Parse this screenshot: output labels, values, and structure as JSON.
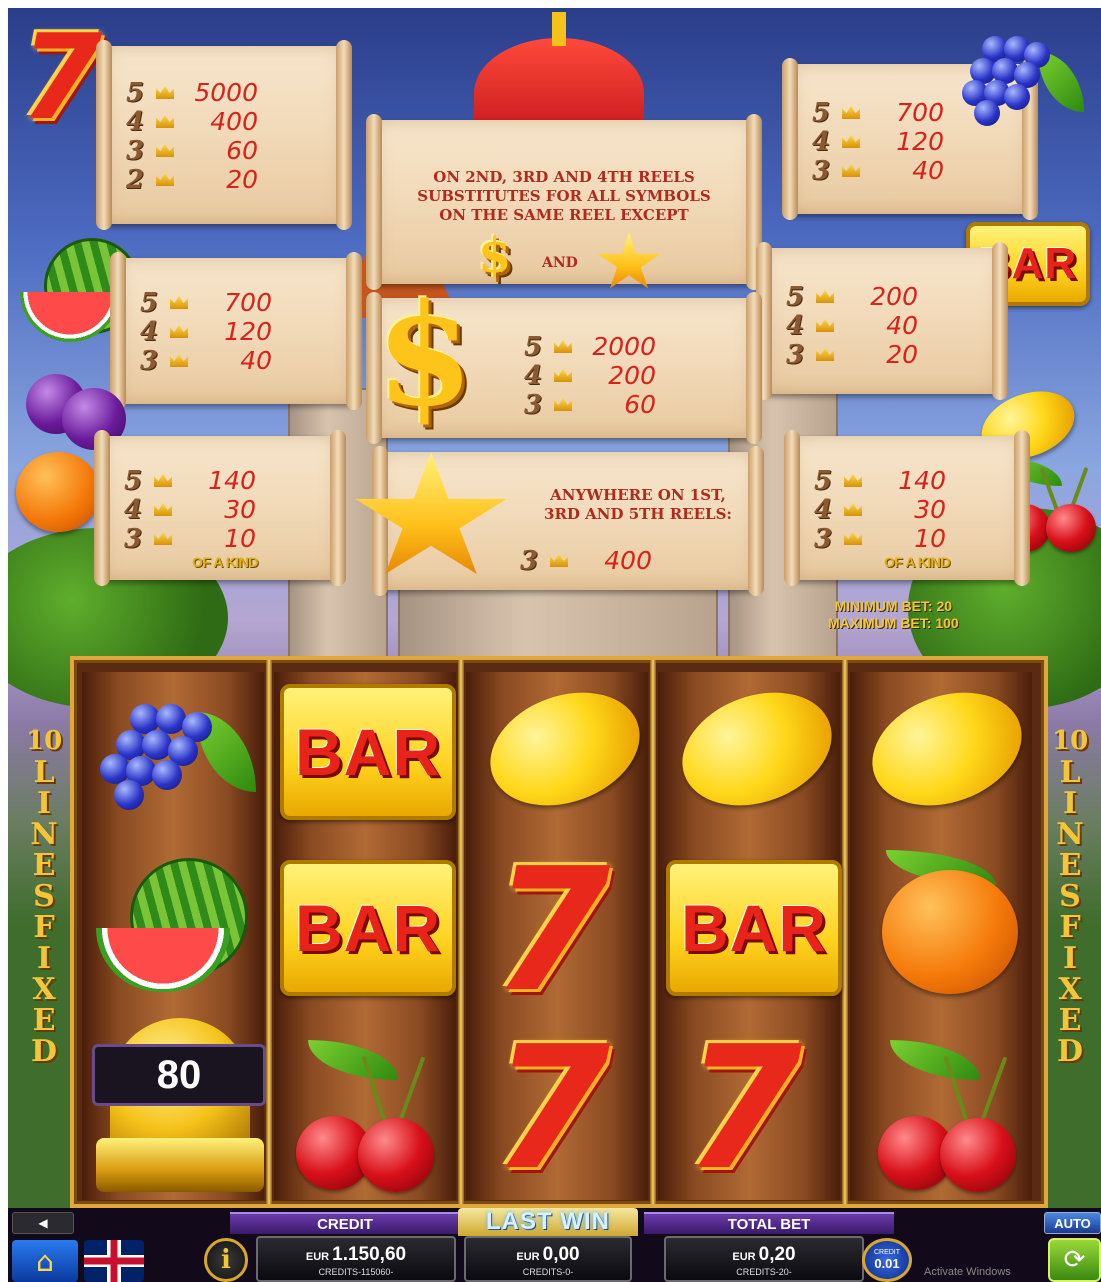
{
  "paytable": {
    "seven": {
      "rows": [
        {
          "count": "5",
          "value": "5000"
        },
        {
          "count": "4",
          "value": "400"
        },
        {
          "count": "3",
          "value": "60"
        },
        {
          "count": "2",
          "value": "20"
        }
      ]
    },
    "grapes": {
      "rows": [
        {
          "count": "5",
          "value": "700"
        },
        {
          "count": "4",
          "value": "120"
        },
        {
          "count": "3",
          "value": "40"
        }
      ]
    },
    "melon": {
      "rows": [
        {
          "count": "5",
          "value": "700"
        },
        {
          "count": "4",
          "value": "120"
        },
        {
          "count": "3",
          "value": "40"
        }
      ]
    },
    "bar": {
      "rows": [
        {
          "count": "5",
          "value": "200"
        },
        {
          "count": "4",
          "value": "40"
        },
        {
          "count": "3",
          "value": "20"
        }
      ]
    },
    "dollar": {
      "rows": [
        {
          "count": "5",
          "value": "2000"
        },
        {
          "count": "4",
          "value": "200"
        },
        {
          "count": "3",
          "value": "60"
        }
      ]
    },
    "plum_orange": {
      "rows": [
        {
          "count": "5",
          "value": "140"
        },
        {
          "count": "4",
          "value": "30"
        },
        {
          "count": "3",
          "value": "10"
        }
      ],
      "footer": "OF A KIND"
    },
    "lemon_cherry": {
      "rows": [
        {
          "count": "5",
          "value": "140"
        },
        {
          "count": "4",
          "value": "30"
        },
        {
          "count": "3",
          "value": "10"
        }
      ],
      "footer": "OF A KIND"
    },
    "star": {
      "text": "ANYWHERE ON 1ST, 3RD AND 5TH REELS:",
      "rows": [
        {
          "count": "3",
          "value": "400"
        }
      ]
    },
    "wild": {
      "text": "ON 2ND, 3RD AND 4TH REELS SUBSTITUTES FOR ALL SYMBOLS ON THE SAME REEL EXCEPT",
      "and": "AND"
    }
  },
  "bar_label": "BAR",
  "seven_label": "7",
  "dollar_label": "$",
  "bet_limits": {
    "min": "MINIMUM BET: 20",
    "max": "MAXIMUM BET: 100"
  },
  "lines": {
    "number": "10",
    "letters": [
      "L",
      "I",
      "N",
      "E",
      "S",
      "F",
      "I",
      "X",
      "E",
      "D"
    ]
  },
  "reels": [
    [
      "grapes",
      "melon",
      "bell"
    ],
    [
      "bar",
      "bar",
      "cherry"
    ],
    [
      "lemon",
      "seven",
      "seven"
    ],
    [
      "lemon",
      "bar",
      "seven"
    ],
    [
      "lemon",
      "orange",
      "cherry"
    ]
  ],
  "bell_value": "80",
  "bottom_bar": {
    "credit": {
      "label": "CREDIT",
      "currency": "EUR",
      "amount": "1.150,60",
      "credits": "CREDITS-115060-"
    },
    "last_win": {
      "label": "LAST WIN",
      "currency": "EUR",
      "amount": "0,00",
      "credits": "CREDITS-0-"
    },
    "total_bet": {
      "label": "TOTAL BET",
      "currency": "EUR",
      "amount": "0,20",
      "credits": "CREDITS-20-"
    },
    "coin": {
      "label": "CREDIT",
      "value": "0.01"
    },
    "auto_label": "AUTO",
    "watermark": "Activate Windows"
  },
  "icons": {
    "home": "home-icon",
    "flag": "uk-flag-icon",
    "info": "info-icon",
    "sound": "speaker-icon",
    "spin": "spin-icon"
  }
}
